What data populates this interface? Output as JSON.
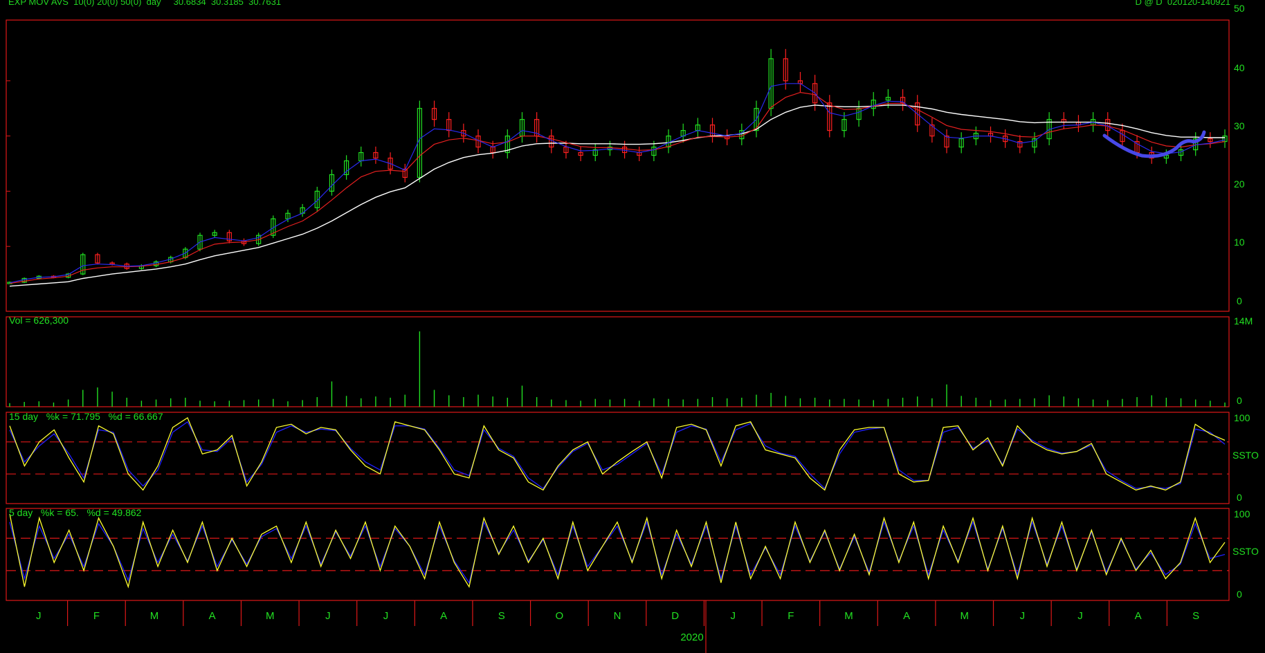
{
  "header": {
    "left": "EXP MOV AVS  10(0) 20(0) 50(0)  day     30.6834  30.3185  30.7631",
    "right": "D @ D  020120-140921"
  },
  "colors": {
    "background": "#000000",
    "frame": "#e01818",
    "text": "#22e022",
    "up_candle": "#22e022",
    "down_candle": "#ff2020",
    "ema10": "#2a2af0",
    "ema20": "#e82020",
    "ema50": "#ffffff",
    "stoch_k": "#ffff30",
    "stoch_d": "#2020ff",
    "annotation": "#4848e8"
  },
  "price_panel": {
    "y_ticks": [
      "50",
      "40",
      "30",
      "20",
      "10",
      "0"
    ]
  },
  "volume_panel": {
    "label": "Vol = 626,300",
    "y_ticks": [
      "14M",
      "0"
    ]
  },
  "stoch15_panel": {
    "label": "15 day   %k = 71.795   %d = 66.667",
    "y_ticks": [
      "100",
      "SSTO",
      "0"
    ]
  },
  "stoch5_panel": {
    "label": "5 day   %k = 65.   %d = 49.862",
    "y_ticks": [
      "100",
      "SSTO",
      "0"
    ]
  },
  "x_axis": {
    "months": [
      "J",
      "F",
      "M",
      "A",
      "M",
      "J",
      "J",
      "A",
      "S",
      "O",
      "N",
      "D",
      "J",
      "F",
      "M",
      "A",
      "M",
      "J",
      "J",
      "A",
      "S"
    ],
    "year_label": "2020"
  },
  "chart_data": [
    {
      "type": "candlestick",
      "series": [
        {
          "name": "price",
          "values": [
            3.5,
            4.2,
            4.6,
            4.4,
            5.0,
            8.5,
            7.0,
            6.8,
            6.0,
            6.5,
            7.2,
            8.0,
            9.5,
            12.0,
            12.5,
            11.0,
            10.5,
            12.0,
            15.0,
            16.0,
            17.0,
            20.0,
            23.0,
            25.5,
            27.0,
            26.0,
            24.0,
            22.5,
            35.0,
            33.0,
            31.0,
            30.0,
            28.0,
            27.0,
            30.0,
            33.0,
            30.0,
            28.0,
            27.0,
            26.5,
            27.5,
            28.0,
            27.0,
            26.5,
            28.0,
            30.0,
            31.0,
            32.0,
            30.0,
            29.5,
            31.0,
            35.0,
            44.0,
            40.0,
            39.5,
            36.0,
            31.0,
            33.0,
            35.0,
            36.5,
            37.0,
            36.0,
            32.0,
            30.0,
            28.0,
            29.5,
            30.5,
            30.0,
            29.0,
            28.0,
            29.5,
            33.0,
            32.5,
            32.0,
            33.0,
            31.0,
            29.0,
            27.0,
            26.0,
            26.5,
            27.5,
            29.5,
            29.0,
            30.0
          ]
        },
        {
          "name": "EMA10",
          "values": [
            3.4,
            4.0,
            4.4,
            4.5,
            4.9,
            6.5,
            6.8,
            6.7,
            6.4,
            6.5,
            7.0,
            7.7,
            8.8,
            10.8,
            11.6,
            11.3,
            11.0,
            11.6,
            13.4,
            14.9,
            16.0,
            18.3,
            21.0,
            23.6,
            25.5,
            25.8,
            25.0,
            23.8,
            29.5,
            31.3,
            31.1,
            30.5,
            29.2,
            28.0,
            29.0,
            31.0,
            30.5,
            29.2,
            28.1,
            27.3,
            27.4,
            27.7,
            27.4,
            27.0,
            27.5,
            28.8,
            30.0,
            31.0,
            30.5,
            30.0,
            30.5,
            33.0,
            39.0,
            39.5,
            39.5,
            37.8,
            34.2,
            33.6,
            34.3,
            35.5,
            36.3,
            36.2,
            34.0,
            31.8,
            29.8,
            29.6,
            30.0,
            30.0,
            29.5,
            28.7,
            29.1,
            31.2,
            31.9,
            32.0,
            32.5,
            31.8,
            30.3,
            28.6,
            27.2,
            26.8,
            27.1,
            28.4,
            28.7,
            29.3
          ]
        },
        {
          "name": "EMA20",
          "values": [
            3.3,
            3.7,
            4.1,
            4.3,
            4.6,
            5.7,
            6.1,
            6.3,
            6.3,
            6.4,
            6.7,
            7.2,
            8.0,
            9.4,
            10.4,
            10.7,
            10.8,
            11.2,
            12.4,
            13.6,
            14.6,
            16.3,
            18.4,
            20.6,
            22.6,
            23.6,
            23.8,
            23.6,
            26.4,
            28.5,
            29.3,
            29.6,
            29.2,
            28.6,
            28.9,
            30.0,
            30.0,
            29.5,
            28.8,
            28.1,
            27.9,
            27.9,
            27.7,
            27.4,
            27.5,
            28.1,
            29.0,
            29.8,
            29.9,
            29.8,
            30.0,
            31.4,
            35.2,
            37.0,
            37.9,
            37.5,
            35.6,
            34.8,
            34.9,
            35.4,
            35.9,
            35.9,
            34.8,
            33.4,
            31.9,
            31.2,
            31.0,
            30.8,
            30.4,
            29.9,
            29.8,
            30.7,
            31.3,
            31.6,
            32.0,
            31.8,
            31.1,
            30.0,
            28.9,
            28.2,
            28.0,
            28.4,
            28.6,
            29.0
          ]
        },
        {
          "name": "EMA50",
          "values": [
            2.8,
            3.0,
            3.2,
            3.4,
            3.6,
            4.2,
            4.6,
            5.0,
            5.3,
            5.6,
            5.9,
            6.3,
            6.8,
            7.6,
            8.3,
            8.8,
            9.3,
            9.8,
            10.6,
            11.4,
            12.2,
            13.3,
            14.6,
            16.1,
            17.6,
            18.9,
            19.9,
            20.6,
            22.3,
            24.0,
            25.2,
            26.1,
            26.6,
            26.9,
            27.4,
            28.2,
            28.6,
            28.7,
            28.7,
            28.6,
            28.6,
            28.6,
            28.5,
            28.5,
            28.6,
            28.8,
            29.2,
            29.7,
            30.0,
            30.1,
            30.4,
            31.2,
            33.0,
            34.3,
            35.2,
            35.6,
            35.4,
            35.3,
            35.3,
            35.4,
            35.6,
            35.6,
            35.3,
            34.9,
            34.3,
            33.9,
            33.6,
            33.3,
            33.0,
            32.6,
            32.4,
            32.5,
            32.5,
            32.5,
            32.5,
            32.3,
            31.9,
            31.3,
            30.6,
            30.1,
            29.8,
            29.8,
            29.7,
            29.7
          ]
        }
      ],
      "ylim": [
        0,
        50
      ]
    },
    {
      "type": "bar",
      "series": [
        {
          "name": "Vol",
          "values": [
            0.6,
            0.8,
            0.9,
            0.7,
            1.2,
            2.8,
            3.2,
            2.5,
            1.5,
            1.0,
            1.2,
            1.4,
            1.5,
            1.0,
            0.9,
            1.0,
            1.1,
            1.2,
            1.3,
            0.9,
            1.1,
            1.6,
            4.2,
            1.8,
            1.4,
            1.7,
            1.5,
            2.0,
            12.5,
            2.8,
            1.9,
            1.6,
            2.0,
            1.7,
            1.5,
            3.5,
            1.6,
            1.2,
            1.1,
            1.0,
            1.3,
            1.2,
            1.3,
            1.0,
            1.4,
            1.3,
            1.2,
            1.3,
            1.6,
            1.4,
            1.5,
            2.0,
            2.3,
            1.8,
            1.4,
            1.5,
            1.2,
            1.3,
            1.2,
            1.1,
            1.3,
            1.5,
            1.7,
            1.4,
            3.7,
            1.8,
            1.5,
            1.1,
            1.2,
            1.3,
            1.4,
            1.9,
            1.7,
            1.4,
            1.2,
            1.1,
            1.3,
            1.6,
            1.9,
            1.5,
            1.4,
            1.2,
            1.0,
            0.7
          ]
        }
      ],
      "ylim": [
        0,
        14
      ]
    },
    {
      "type": "line",
      "series": [
        {
          "name": "%k",
          "values": [
            90,
            40,
            70,
            85,
            50,
            20,
            90,
            80,
            30,
            10,
            40,
            88,
            100,
            55,
            60,
            78,
            15,
            45,
            88,
            92,
            80,
            88,
            85,
            60,
            40,
            30,
            95,
            90,
            85,
            60,
            30,
            25,
            90,
            60,
            50,
            20,
            10,
            40,
            60,
            70,
            30,
            45,
            58,
            70,
            25,
            88,
            92,
            85,
            40,
            90,
            95,
            60,
            55,
            50,
            25,
            10,
            60,
            85,
            88,
            88,
            30,
            20,
            22,
            88,
            90,
            60,
            75,
            40,
            90,
            70,
            60,
            55,
            58,
            68,
            30,
            20,
            10,
            15,
            10,
            20,
            92,
            80,
            72
          ]
        },
        {
          "name": "%d",
          "values": [
            85,
            45,
            65,
            80,
            55,
            25,
            85,
            82,
            35,
            15,
            35,
            82,
            95,
            60,
            58,
            75,
            20,
            42,
            82,
            90,
            82,
            86,
            84,
            62,
            45,
            35,
            90,
            90,
            86,
            62,
            35,
            28,
            85,
            62,
            52,
            25,
            12,
            38,
            58,
            68,
            35,
            42,
            55,
            68,
            30,
            82,
            90,
            86,
            45,
            85,
            93,
            65,
            56,
            52,
            30,
            12,
            55,
            82,
            86,
            88,
            35,
            22,
            22,
            82,
            88,
            62,
            72,
            42,
            86,
            72,
            62,
            56,
            58,
            66,
            34,
            22,
            12,
            14,
            12,
            18,
            86,
            82,
            67
          ]
        }
      ],
      "ylim": [
        0,
        100
      ]
    },
    {
      "type": "line",
      "series": [
        {
          "name": "%k",
          "values": [
            100,
            10,
            95,
            40,
            80,
            30,
            95,
            60,
            10,
            90,
            35,
            80,
            40,
            90,
            30,
            70,
            35,
            75,
            85,
            40,
            90,
            35,
            80,
            45,
            90,
            30,
            85,
            60,
            20,
            90,
            40,
            10,
            95,
            50,
            85,
            40,
            70,
            20,
            90,
            30,
            60,
            90,
            40,
            95,
            20,
            80,
            35,
            90,
            15,
            90,
            20,
            60,
            20,
            90,
            40,
            80,
            30,
            75,
            25,
            95,
            40,
            90,
            20,
            85,
            40,
            95,
            30,
            85,
            20,
            95,
            35,
            90,
            30,
            80,
            25,
            70,
            30,
            55,
            20,
            40,
            95,
            40,
            65
          ]
        },
        {
          "name": "%d",
          "values": [
            90,
            20,
            85,
            45,
            75,
            35,
            88,
            60,
            18,
            82,
            40,
            75,
            42,
            85,
            35,
            68,
            38,
            72,
            82,
            45,
            85,
            38,
            78,
            48,
            85,
            35,
            82,
            60,
            25,
            85,
            42,
            15,
            90,
            52,
            80,
            42,
            68,
            25,
            85,
            35,
            60,
            85,
            42,
            90,
            25,
            75,
            38,
            85,
            20,
            85,
            25,
            58,
            25,
            85,
            42,
            78,
            32,
            72,
            28,
            90,
            42,
            85,
            25,
            80,
            42,
            90,
            32,
            82,
            25,
            90,
            38,
            85,
            32,
            78,
            28,
            68,
            32,
            52,
            25,
            38,
            88,
            45,
            50
          ]
        }
      ],
      "ylim": [
        0,
        100
      ]
    }
  ]
}
